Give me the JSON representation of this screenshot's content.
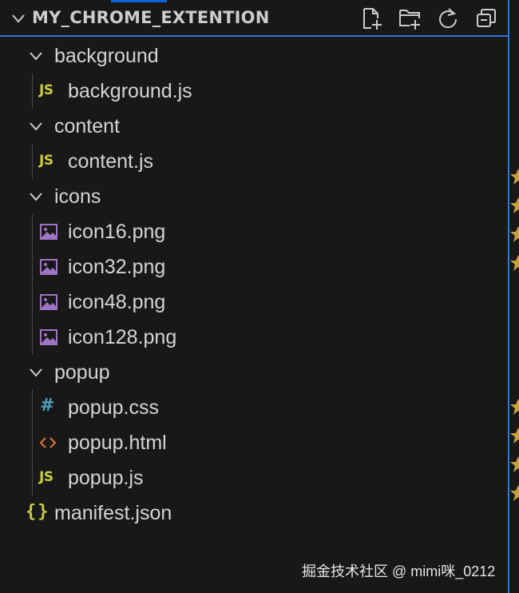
{
  "explorer": {
    "title": "MY_CHROME_EXTENTION",
    "toolbar": {
      "new_file": "new-file-icon",
      "new_folder": "new-folder-icon",
      "refresh": "refresh-icon",
      "collapse_all": "collapse-all-icon"
    }
  },
  "tree": {
    "background": {
      "folder": "background",
      "files": [
        "background.js"
      ]
    },
    "content": {
      "folder": "content",
      "files": [
        "content.js"
      ]
    },
    "icons": {
      "folder": "icons",
      "files": [
        "icon16.png",
        "icon32.png",
        "icon48.png",
        "icon128.png"
      ]
    },
    "popup": {
      "folder": "popup",
      "files": [
        "popup.css",
        "popup.html",
        "popup.js"
      ]
    },
    "root_files": [
      "manifest.json"
    ]
  },
  "icon_glyphs": {
    "js": "JS",
    "css": "#",
    "json": "{}"
  },
  "colors": {
    "background": "#181818",
    "text": "#d4d4d4",
    "accent": "#2b79d8",
    "js_yellow": "#cbcb41",
    "css_blue": "#519aba",
    "html_orange": "#e37933",
    "image_purple": "#a074c4"
  },
  "watermark": "掘金技术社区 @ mimi咪_0212"
}
